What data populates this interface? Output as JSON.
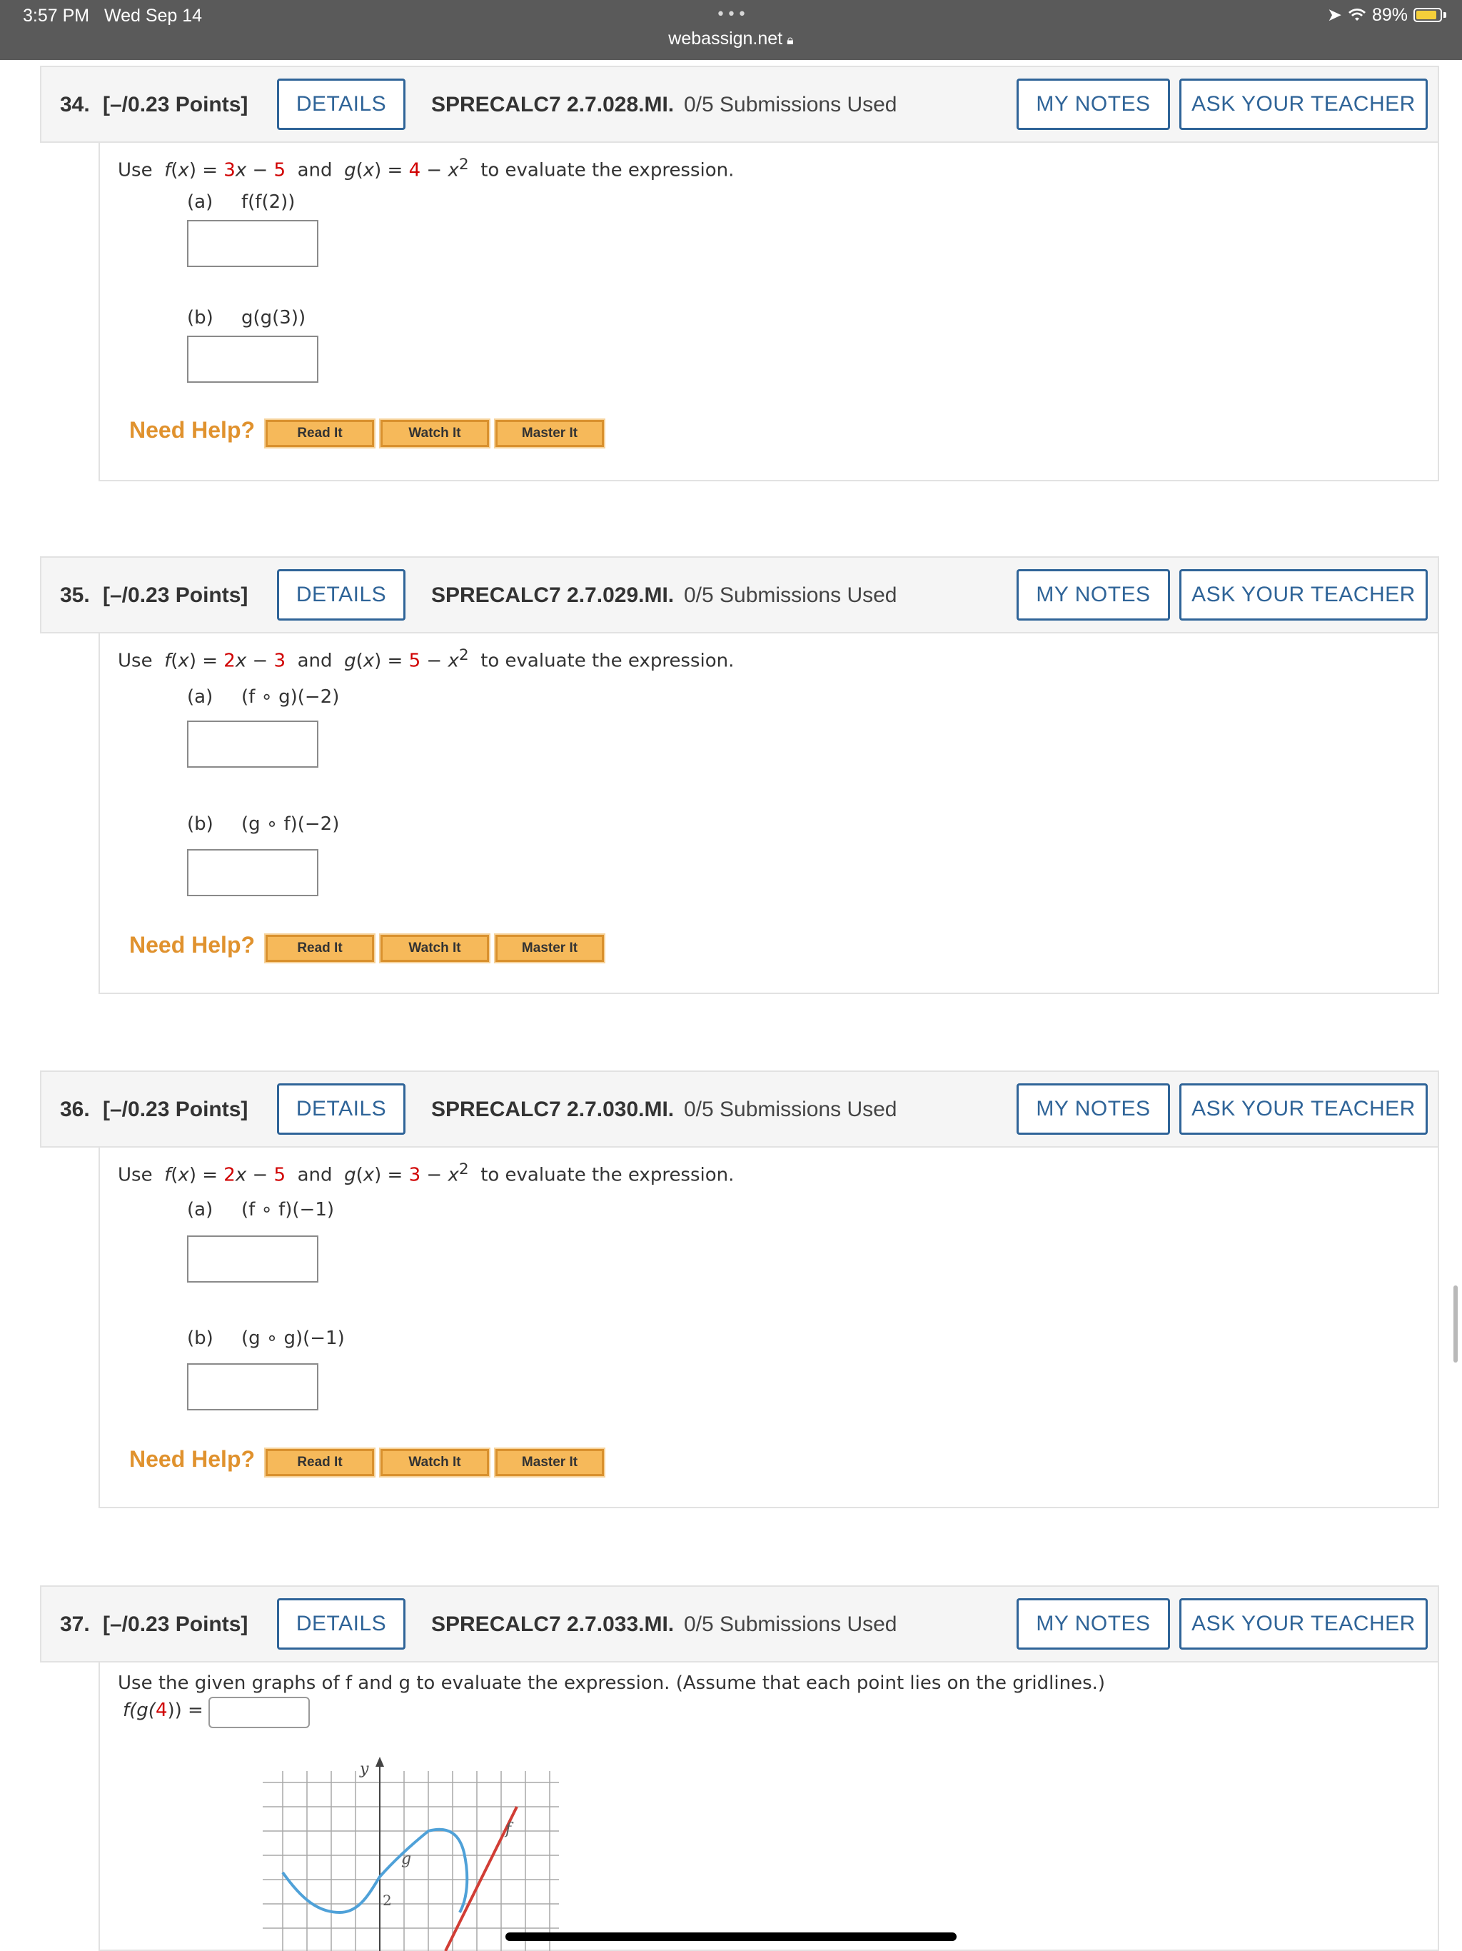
{
  "status_bar": {
    "time": "3:57 PM",
    "date": "Wed Sep 14",
    "dots": "•••",
    "url": "webassign.net",
    "battery": "89%",
    "battery_level": 0.89
  },
  "common": {
    "details": "DETAILS",
    "my_notes": "MY NOTES",
    "ask_teacher": "ASK YOUR TEACHER",
    "need_help": "Need Help?",
    "read_it": "Read It",
    "watch_it": "Watch It",
    "master_it": "Master It",
    "use": "Use",
    "and": "and",
    "to_eval": "to evaluate the expression.",
    "minus": "−"
  },
  "questions": [
    {
      "number": "34.",
      "points": "[–/0.23 Points]",
      "code": "SPRECALC7 2.7.028.MI.",
      "submissions": "0/5 Submissions Used",
      "f_coef": "3",
      "f_const": "5",
      "g_const": "4",
      "part_a_label": "(a)",
      "part_a_expr": "f(f(2))",
      "part_b_label": "(b)",
      "part_b_expr": "g(g(3))"
    },
    {
      "number": "35.",
      "points": "[–/0.23 Points]",
      "code": "SPRECALC7 2.7.029.MI.",
      "submissions": "0/5 Submissions Used",
      "f_coef": "2",
      "f_const": "3",
      "g_const": "5",
      "part_a_label": "(a)",
      "part_a_expr": "(f ∘ g)(−2)",
      "part_b_label": "(b)",
      "part_b_expr": "(g ∘ f)(−2)"
    },
    {
      "number": "36.",
      "points": "[–/0.23 Points]",
      "code": "SPRECALC7 2.7.030.MI.",
      "submissions": "0/5 Submissions Used",
      "f_coef": "2",
      "f_const": "5",
      "g_const": "3",
      "part_a_label": "(a)",
      "part_a_expr": "(f ∘ f)(−1)",
      "part_b_label": "(b)",
      "part_b_expr": "(g ∘ g)(−1)"
    },
    {
      "number": "37.",
      "points": "[–/0.23 Points]",
      "code": "SPRECALC7 2.7.033.MI.",
      "submissions": "0/5 Submissions Used",
      "prompt": "Use the given graphs of f and g to evaluate the expression. (Assume that each point lies on the gridlines.)",
      "expr_prefix": "f(g(",
      "expr_value": "4",
      "expr_suffix": ")) =",
      "graph": {
        "y_label": "y",
        "f_label": "f",
        "g_label": "g",
        "tick_label": "2"
      }
    }
  ]
}
